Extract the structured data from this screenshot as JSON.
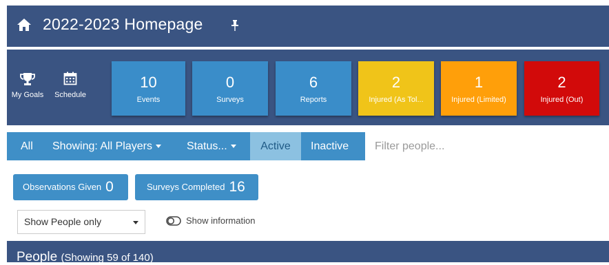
{
  "header": {
    "title": "2022-2023 Homepage"
  },
  "nav": {
    "goals_label": "My Goals",
    "schedule_label": "Schedule"
  },
  "tiles": [
    {
      "value": "10",
      "label": "Events",
      "color": "#3a8dc9"
    },
    {
      "value": "0",
      "label": "Surveys",
      "color": "#3a8dc9"
    },
    {
      "value": "6",
      "label": "Reports",
      "color": "#3a8dc9"
    },
    {
      "value": "2",
      "label": "Injured (As Tol...",
      "color": "#f0c419"
    },
    {
      "value": "1",
      "label": "Injured (Limited)",
      "color": "#ff9f0a"
    },
    {
      "value": "2",
      "label": "Injured (Out)",
      "color": "#d20a0a"
    }
  ],
  "filterbar": {
    "all_label": "All",
    "showing_label": "Showing: All Players",
    "status_label": "Status...",
    "active_label": "Active",
    "inactive_label": "Inactive",
    "filter_placeholder": "Filter people..."
  },
  "counts": {
    "observations_label": "Observations Given",
    "observations_value": "0",
    "surveys_label": "Surveys Completed",
    "surveys_value": "16"
  },
  "options": {
    "show_select_value": "Show People only",
    "show_information_label": "Show information"
  },
  "people": {
    "title": "People",
    "subtitle": "(Showing 59 of 140)"
  }
}
